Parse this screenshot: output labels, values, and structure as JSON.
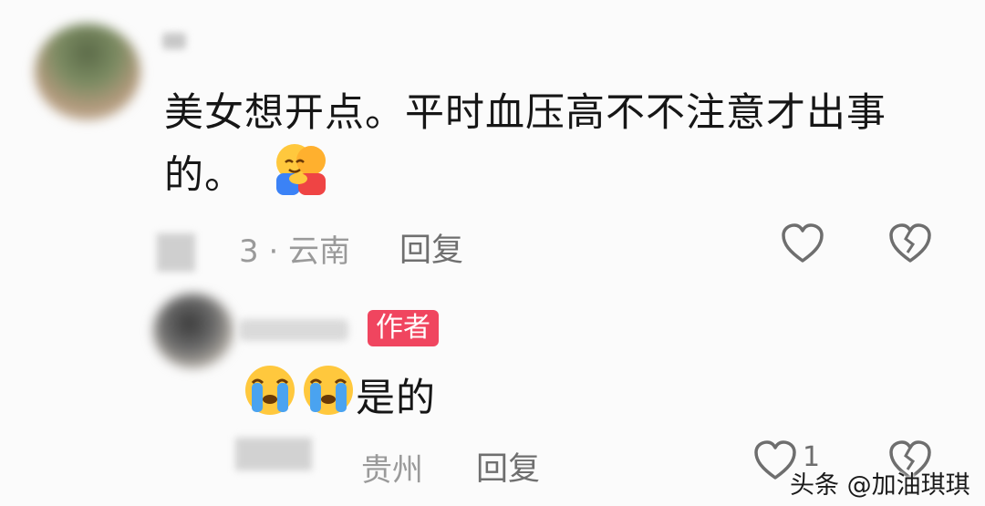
{
  "comment1": {
    "text_line1": "美女想开点。平时血压高不不注意才出事",
    "text_line2": "的。",
    "meta_suffix": "3 · 云南",
    "reply_label": "回复"
  },
  "comment2": {
    "badge_label": "作者",
    "text": "是的",
    "location": "贵州",
    "reply_label": "回复",
    "like_count": "1"
  },
  "watermark": "头条 @加油琪琪",
  "icons": [
    "hug-emoji",
    "heart-icon",
    "broken-heart-icon",
    "crying-emoji"
  ]
}
